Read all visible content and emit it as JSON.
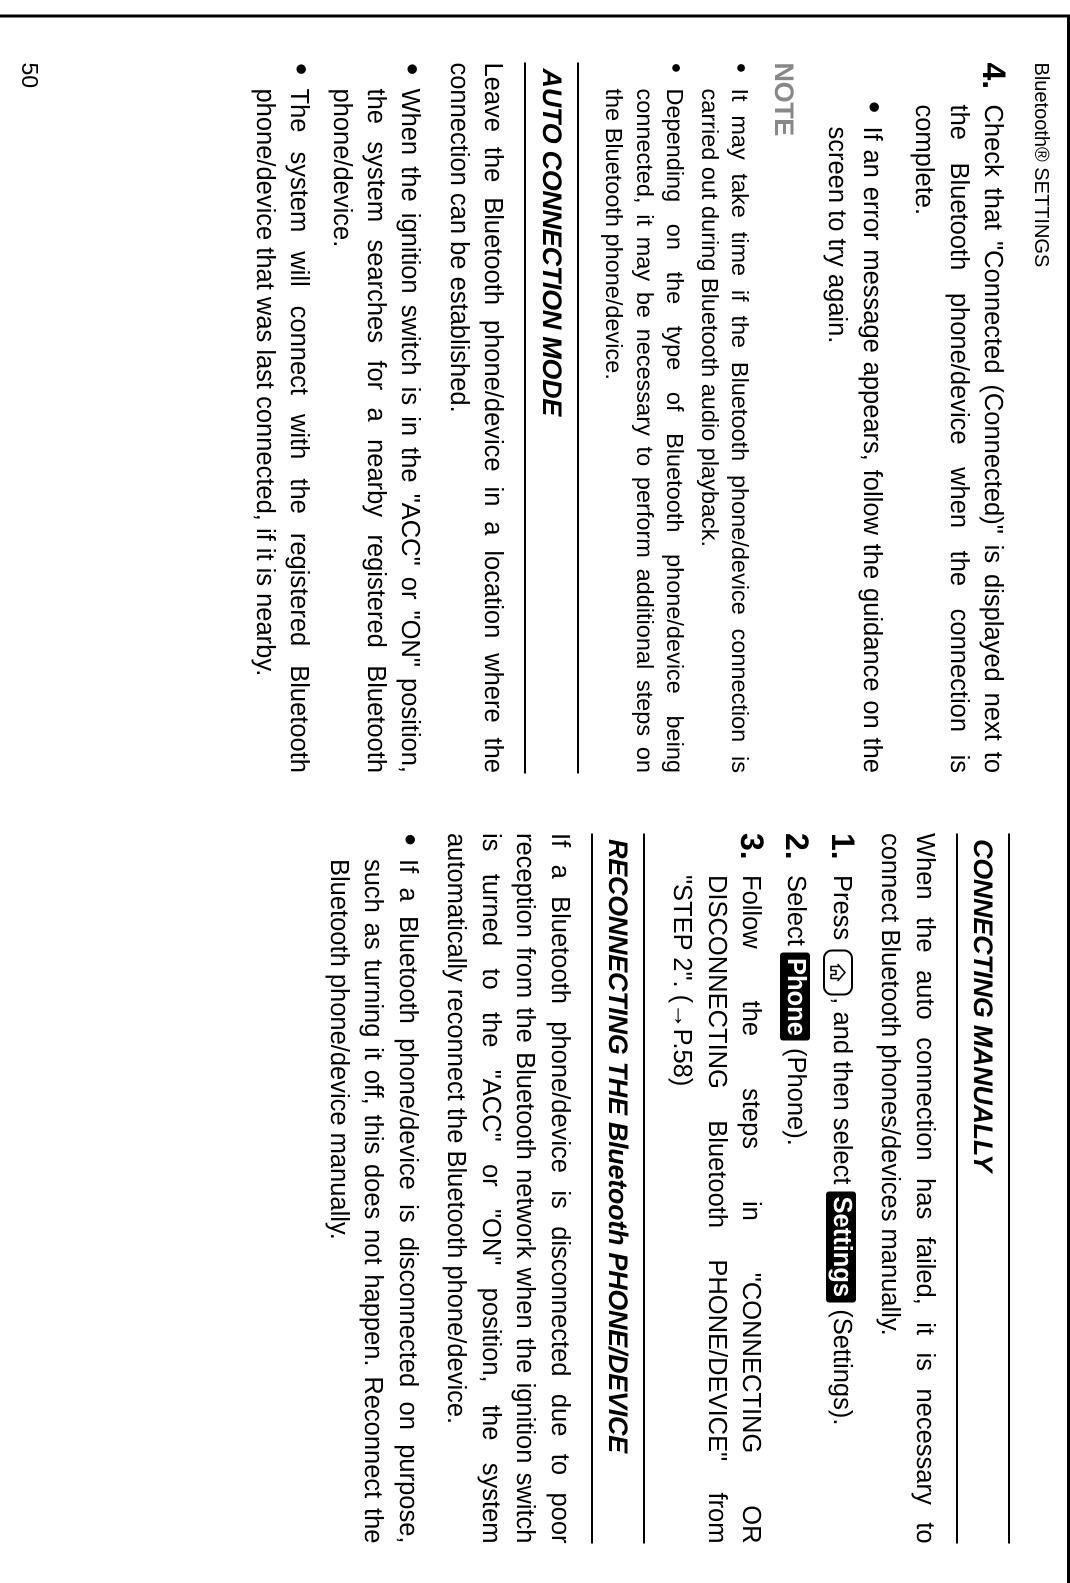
{
  "header": "Bluetooth® SETTINGS",
  "page_number": "50",
  "left": {
    "step4_num": "4.",
    "step4_text": "Check that \"Connected (Connected)\" is displayed next to the Bluetooth phone/device when the connection is complete.",
    "bullet1": "If an error message appears, follow the guidance on the screen to try again.",
    "note_label": "NOTE",
    "note_b1": "It may take time if the Bluetooth phone/device connection is carried out during Bluetooth audio playback.",
    "note_b2": "Depending on the type of Bluetooth phone/device being connected, it may be necessary to perform additional steps on the Bluetooth phone/device.",
    "heading_auto": "AUTO CONNECTION MODE",
    "auto_p1": "Leave the Bluetooth phone/device in a location where the connection can be established.",
    "auto_b1": "When the ignition switch is in the \"ACC\" or \"ON\" position, the system searches for a nearby registered Bluetooth phone/device.",
    "auto_b2": "The system will connect with the registered Bluetooth phone/device that was last connected, if it is nearby."
  },
  "right": {
    "heading_manual": "CONNECTING MANUALLY",
    "manual_p1": "When the auto connection has failed, it is necessary to connect Bluetooth phones/devices manually.",
    "s1_num": "1.",
    "s1_pre": "Press",
    "s1_mid": ", and then select",
    "s1_inv": "Settings",
    "s1_post": "(Settings).",
    "s2_num": "2.",
    "s2_pre": "Select",
    "s2_inv": "Phone",
    "s2_post": "(Phone).",
    "s3_num": "3.",
    "s3_text_a": "Follow the steps in \"CONNECTING OR",
    "s3_text_b": "DISCONNECTING Bluetooth PHONE/DEVICE\" from",
    "s3_text_c": "\"STEP 2\". (→P.58)",
    "heading_reconnect": "RECONNECTING THE Bluetooth PHONE/DEVICE",
    "reconnect_p1": "If a Bluetooth phone/device is disconnected due to poor reception from the Bluetooth network when the ignition switch is turned to the \"ACC\" or \"ON\" position, the system automatically reconnect the Bluetooth phone/device.",
    "reconnect_b1": "If a Bluetooth phone/device is disconnected on purpose, such as turning it off, this does not happen. Reconnect the Bluetooth phone/device manually."
  }
}
